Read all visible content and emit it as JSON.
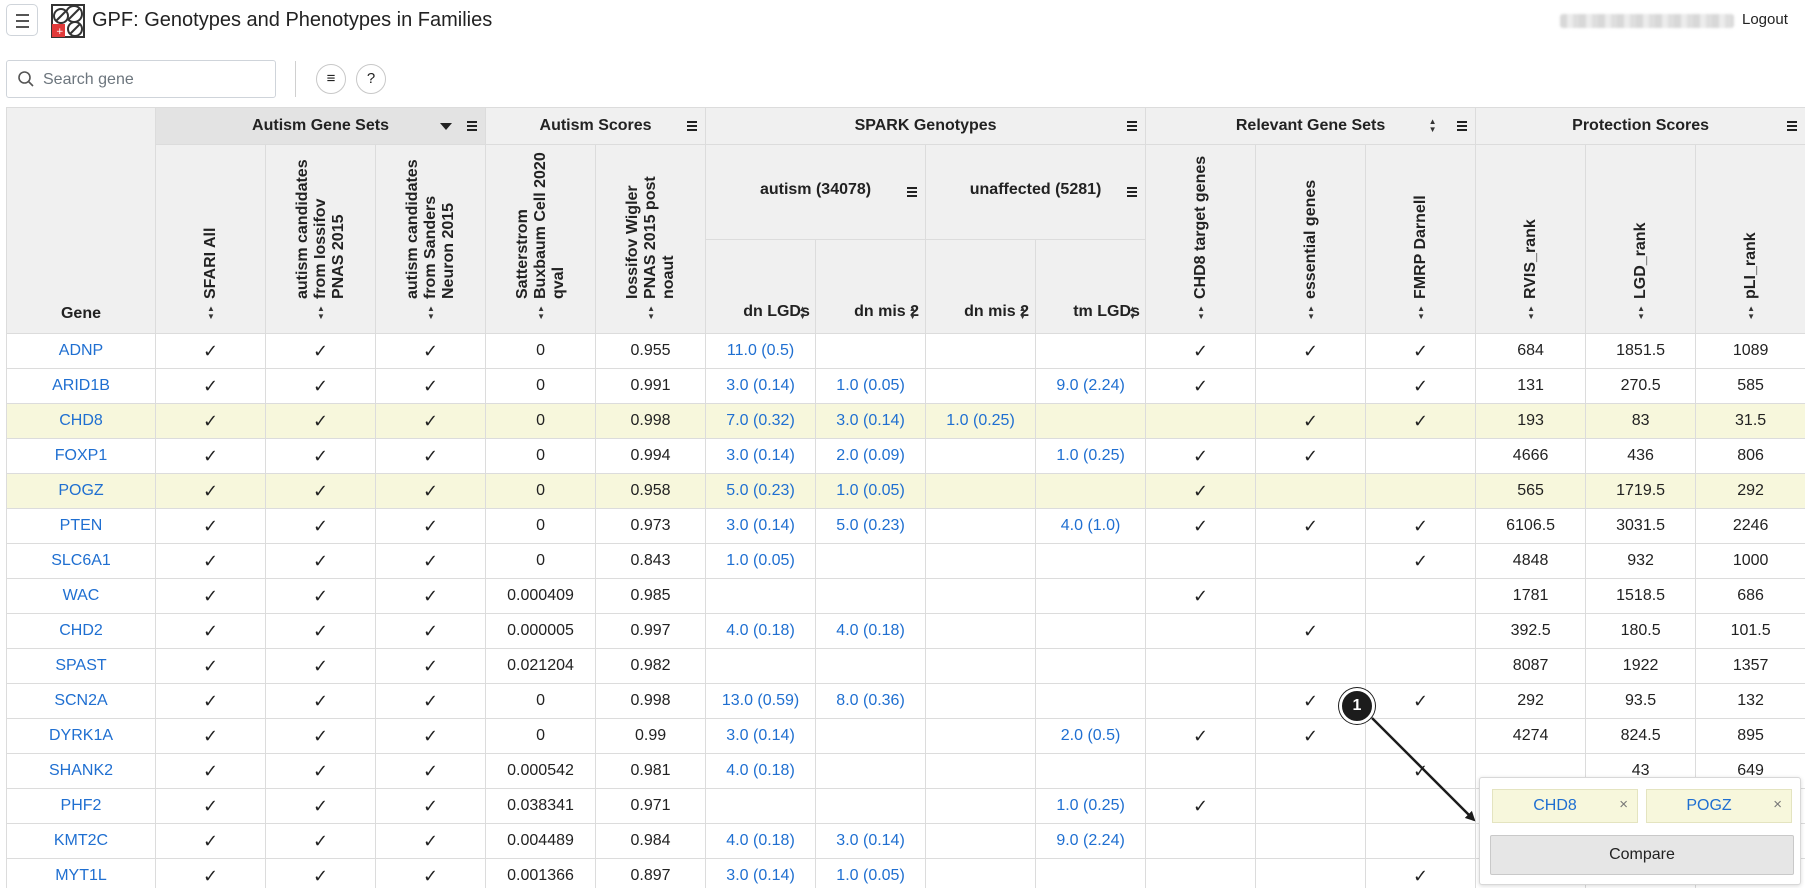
{
  "app": {
    "title": "GPF: Genotypes and Phenotypes in Families",
    "logout_label": "Logout"
  },
  "icons": {
    "menu": "hamburger-menu-icon",
    "logo": "gpf-logo-icon",
    "search": "search-icon",
    "legend": "legend-menu-icon",
    "help": "help-icon",
    "sort": "sort-icon",
    "column_menu": "column-menu-icon",
    "dropdown": "caret-down-icon",
    "remove": "close-icon"
  },
  "toolbar": {
    "search_placeholder": "Search gene",
    "legend_button": "≡",
    "help_button": "?"
  },
  "table": {
    "gene_header": "Gene",
    "groups": [
      {
        "label": "Autism Gene Sets"
      },
      {
        "label": "Autism Scores"
      },
      {
        "label": "SPARK Genotypes"
      },
      {
        "label": "Relevant Gene Sets"
      },
      {
        "label": "Protection Scores"
      }
    ],
    "spark_subgroups": [
      {
        "label": "autism (34078)"
      },
      {
        "label": "unaffected (5281)"
      }
    ],
    "columns": [
      {
        "label": [
          "SFARI All"
        ]
      },
      {
        "label": [
          "autism candidates",
          "from Iossifov",
          "PNAS 2015"
        ]
      },
      {
        "label": [
          "autism candidates",
          "from Sanders",
          "Neuron 2015"
        ]
      },
      {
        "label": [
          "Satterstrom",
          "Buxbaum Cell 2020",
          "qval"
        ]
      },
      {
        "label": [
          "Iossifov Wigler",
          "PNAS 2015 post",
          "noaut"
        ]
      },
      {
        "label": "dn LGDs"
      },
      {
        "label": "dn mis 2"
      },
      {
        "label": "dn mis 2"
      },
      {
        "label": "tm LGDs"
      },
      {
        "label": [
          "CHD8 target genes"
        ]
      },
      {
        "label": [
          "essential genes"
        ]
      },
      {
        "label": [
          "FMRP Darnell"
        ]
      },
      {
        "label": [
          "RVIS_rank"
        ]
      },
      {
        "label": [
          "LGD_rank"
        ]
      },
      {
        "label": [
          "pLI_rank"
        ]
      }
    ],
    "check_mark": "✓",
    "rows": [
      {
        "gene": "ADNP",
        "selected": false,
        "values": [
          "✓",
          "✓",
          "✓",
          "0",
          "0.955",
          "11.0 (0.5)",
          "",
          "",
          "",
          "✓",
          "✓",
          "✓",
          "684",
          "1851.5",
          "1089"
        ]
      },
      {
        "gene": "ARID1B",
        "selected": false,
        "values": [
          "✓",
          "✓",
          "✓",
          "0",
          "0.991",
          "3.0 (0.14)",
          "1.0 (0.05)",
          "",
          "9.0 (2.24)",
          "✓",
          "",
          "✓",
          "131",
          "270.5",
          "585"
        ]
      },
      {
        "gene": "CHD8",
        "selected": true,
        "values": [
          "✓",
          "✓",
          "✓",
          "0",
          "0.998",
          "7.0 (0.32)",
          "3.0 (0.14)",
          "1.0 (0.25)",
          "",
          "",
          "✓",
          "✓",
          "193",
          "83",
          "31.5"
        ]
      },
      {
        "gene": "FOXP1",
        "selected": false,
        "values": [
          "✓",
          "✓",
          "✓",
          "0",
          "0.994",
          "3.0 (0.14)",
          "2.0 (0.09)",
          "",
          "1.0 (0.25)",
          "✓",
          "✓",
          "",
          "4666",
          "436",
          "806"
        ]
      },
      {
        "gene": "POGZ",
        "selected": true,
        "values": [
          "✓",
          "✓",
          "✓",
          "0",
          "0.958",
          "5.0 (0.23)",
          "1.0 (0.05)",
          "",
          "",
          "✓",
          "",
          "",
          "565",
          "1719.5",
          "292"
        ]
      },
      {
        "gene": "PTEN",
        "selected": false,
        "values": [
          "✓",
          "✓",
          "✓",
          "0",
          "0.973",
          "3.0 (0.14)",
          "5.0 (0.23)",
          "",
          "4.0 (1.0)",
          "✓",
          "✓",
          "✓",
          "6106.5",
          "3031.5",
          "2246"
        ]
      },
      {
        "gene": "SLC6A1",
        "selected": false,
        "values": [
          "✓",
          "✓",
          "✓",
          "0",
          "0.843",
          "1.0 (0.05)",
          "",
          "",
          "",
          "",
          "",
          "✓",
          "4848",
          "932",
          "1000"
        ]
      },
      {
        "gene": "WAC",
        "selected": false,
        "values": [
          "✓",
          "✓",
          "✓",
          "0.000409",
          "0.985",
          "",
          "",
          "",
          "",
          "✓",
          "",
          "",
          "1781",
          "1518.5",
          "686"
        ]
      },
      {
        "gene": "CHD2",
        "selected": false,
        "values": [
          "✓",
          "✓",
          "✓",
          "0.000005",
          "0.997",
          "4.0 (0.18)",
          "4.0 (0.18)",
          "",
          "",
          "",
          "✓",
          "",
          "392.5",
          "180.5",
          "101.5"
        ]
      },
      {
        "gene": "SPAST",
        "selected": false,
        "values": [
          "✓",
          "✓",
          "✓",
          "0.021204",
          "0.982",
          "",
          "",
          "",
          "",
          "",
          "",
          "",
          "8087",
          "1922",
          "1357"
        ]
      },
      {
        "gene": "SCN2A",
        "selected": false,
        "values": [
          "✓",
          "✓",
          "✓",
          "0",
          "0.998",
          "13.0 (0.59)",
          "8.0 (0.36)",
          "",
          "",
          "",
          "✓",
          "✓",
          "292",
          "93.5",
          "132"
        ]
      },
      {
        "gene": "DYRK1A",
        "selected": false,
        "values": [
          "✓",
          "✓",
          "✓",
          "0",
          "0.99",
          "3.0 (0.14)",
          "",
          "",
          "2.0 (0.5)",
          "✓",
          "✓",
          "",
          "4274",
          "824.5",
          "895"
        ]
      },
      {
        "gene": "SHANK2",
        "selected": false,
        "values": [
          "✓",
          "✓",
          "✓",
          "0.000542",
          "0.981",
          "4.0 (0.18)",
          "",
          "",
          "",
          "",
          "",
          "✓",
          "",
          "43",
          "649"
        ]
      },
      {
        "gene": "PHF2",
        "selected": false,
        "values": [
          "✓",
          "✓",
          "✓",
          "0.038341",
          "0.971",
          "",
          "",
          "",
          "1.0 (0.25)",
          "✓",
          "",
          "",
          "",
          "",
          ""
        ]
      },
      {
        "gene": "KMT2C",
        "selected": false,
        "values": [
          "✓",
          "✓",
          "✓",
          "0.004489",
          "0.984",
          "4.0 (0.18)",
          "3.0 (0.14)",
          "",
          "9.0 (2.24)",
          "",
          "",
          "",
          "",
          "",
          ""
        ]
      },
      {
        "gene": "MYT1L",
        "selected": false,
        "values": [
          "✓",
          "✓",
          "✓",
          "0.001366",
          "0.897",
          "3.0 (0.14)",
          "1.0 (0.05)",
          "",
          "",
          "",
          "",
          "✓",
          "",
          "",
          ""
        ]
      }
    ]
  },
  "compare_panel": {
    "chips": [
      {
        "label": "CHD8",
        "remove": "×"
      },
      {
        "label": "POGZ",
        "remove": "×"
      }
    ],
    "button_label": "Compare"
  },
  "annotation": {
    "marker": "1"
  },
  "colors": {
    "link": "#1f6fd1",
    "selected_row": "#f7f7dc",
    "header_bg": "#f0f0f0"
  }
}
